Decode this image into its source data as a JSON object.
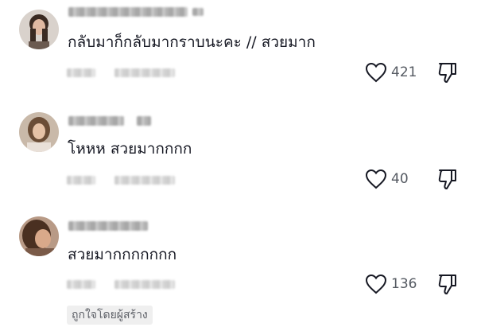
{
  "comments": [
    {
      "text": "กลับมาก็กลับมากราบนะคะ // สวยมาก",
      "like_count": "421"
    },
    {
      "text": "โหหห สวยมากกกก",
      "like_count": "40"
    },
    {
      "text": "สวยมากกกกกกก",
      "like_count": "136",
      "creator_liked_label": "ถูกใจโดยผู้สร้าง"
    }
  ],
  "icons": {
    "like": "heart-outline-icon",
    "dislike": "thumbs-down-outline-icon"
  },
  "colors": {
    "text": "#161823",
    "count": "#555a62",
    "badge_bg": "#efefef"
  }
}
